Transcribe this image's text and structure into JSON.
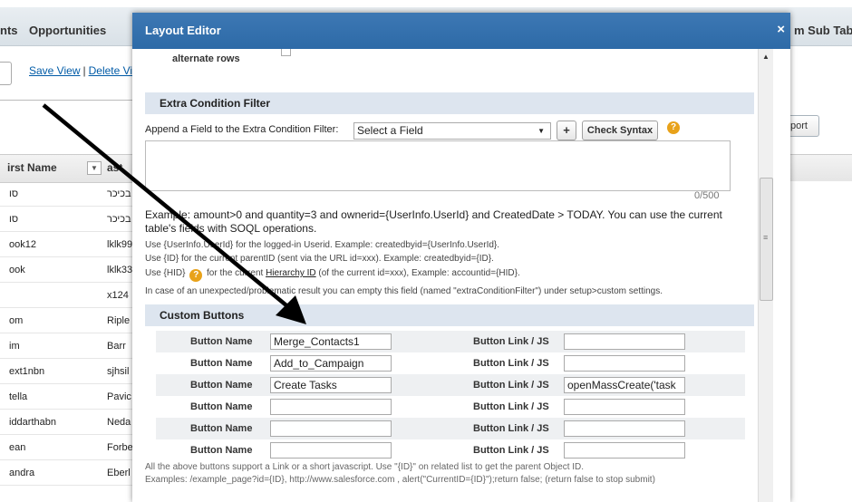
{
  "background": {
    "tabs": [
      "nts",
      "Opportunities",
      "m Sub Tab"
    ],
    "links": [
      "Save View",
      "Delete Vi"
    ],
    "export_label": "port",
    "columns": [
      "irst Name",
      "ast"
    ],
    "rows": [
      [
        "סו",
        "בכיכר"
      ],
      [
        "סו",
        "בכיכר"
      ],
      [
        "ook12",
        "lklk99"
      ],
      [
        "ook",
        "lklk33"
      ],
      [
        "",
        "x124"
      ],
      [
        "om",
        "Riple"
      ],
      [
        "im",
        "Barr"
      ],
      [
        "ext1nbn",
        "sjhsil"
      ],
      [
        "tella",
        "Pavic"
      ],
      [
        "iddarthabn",
        "Neda"
      ],
      [
        "ean",
        "Forbe"
      ],
      [
        "andra",
        "Eberl"
      ]
    ]
  },
  "modal": {
    "title": "Layout Editor",
    "close": "×",
    "alt_rows_label": "alternate rows",
    "extra_filter": {
      "heading": "Extra Condition Filter",
      "append_label": "Append a Field to the Extra Condition Filter:",
      "select_value": "Select a Field",
      "plus_label": "+",
      "check_syntax_label": "Check Syntax",
      "counter": "0/500",
      "example": "Example: amount>0 and quantity=3 and ownerid={UserInfo.UserId} and CreatedDate > TODAY. You can use the current table's fields with SOQL operations.",
      "hint1": "Use {UserInfo.UserId} for the logged-in Userid. Example: createdbyid={UserInfo.UserId}.",
      "hint2": "Use {ID} for the current parentID (sent via the URL id=xxx). Example: createdbyid={ID}.",
      "hint3_pre": "Use {HID}",
      "hint3_mid": " for the current ",
      "hint3_link": "Hierarchy ID",
      "hint3_post": " (of the current id=xxx), Example: accountid={HID}.",
      "hint4": "In case of an unexpected/problematic result you can empty this field (named \"extraConditionFilter\") under setup>custom settings."
    },
    "custom_buttons": {
      "heading": "Custom Buttons",
      "name_label": "Button Name",
      "link_label": "Button Link / JS",
      "rows": [
        {
          "name": "Merge_Contacts1",
          "link": ""
        },
        {
          "name": "Add_to_Campaign",
          "link": ""
        },
        {
          "name": "Create Tasks",
          "link": "openMassCreate('task"
        },
        {
          "name": "",
          "link": ""
        },
        {
          "name": "",
          "link": ""
        },
        {
          "name": "",
          "link": ""
        }
      ],
      "footnote1": "All the above buttons support a Link or a short javascript. Use \"{ID}\" on related list to get the parent Object ID.",
      "footnote2": "Examples: /example_page?id={ID}, http://www.salesforce.com , alert(\"CurrentID={ID}\");return false; (return false to stop submit)"
    }
  },
  "colors": {
    "modal_header": "#2d6aa7",
    "section_header": "#dde5ef",
    "help_icon": "#e8a21a",
    "arrow": "#000000"
  }
}
